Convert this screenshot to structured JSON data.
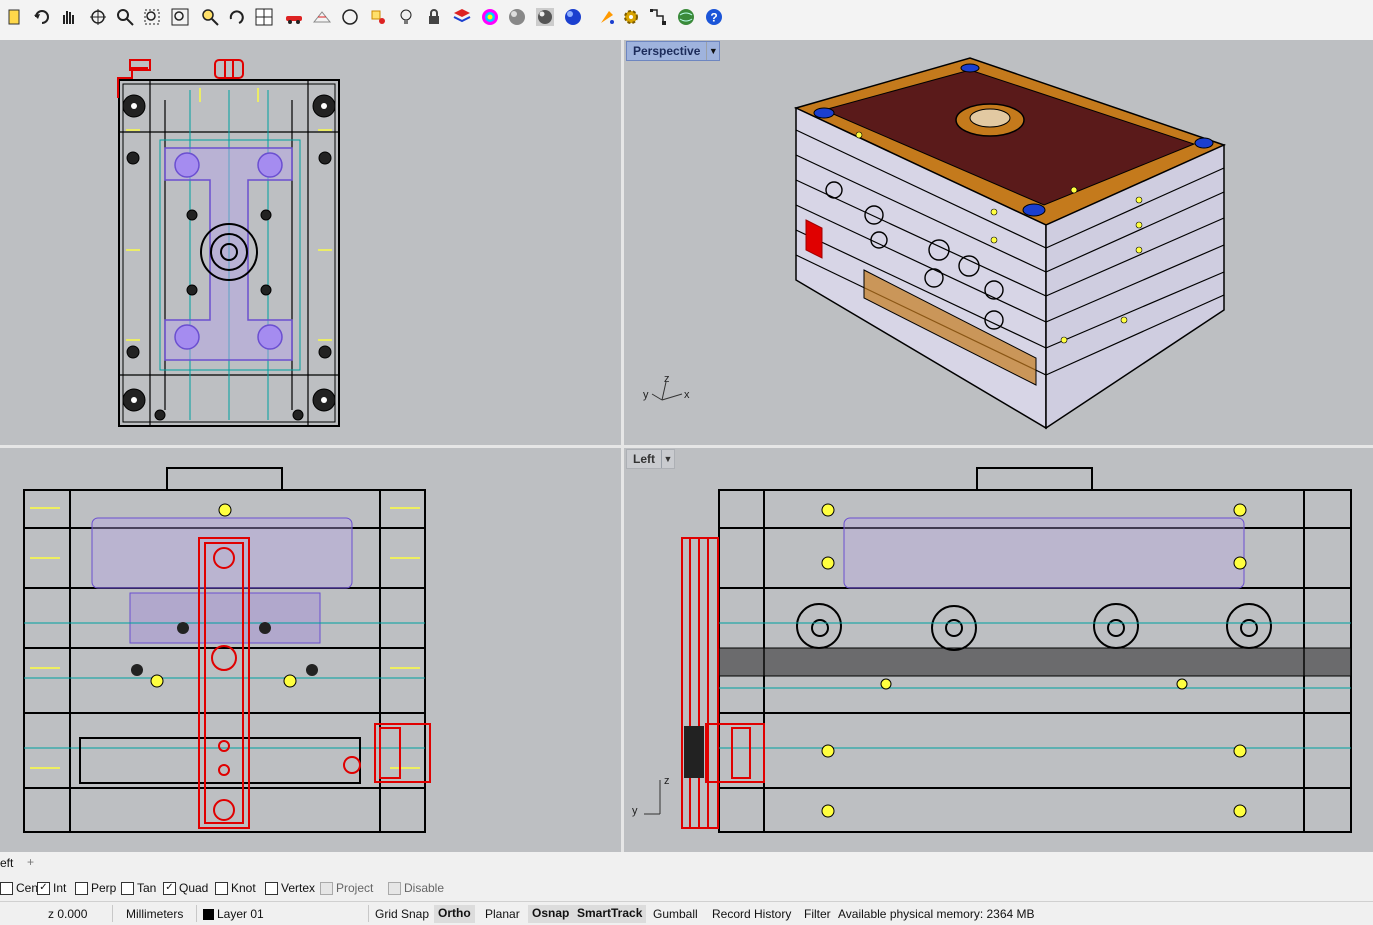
{
  "toolbar": {
    "icons": [
      "new-file-icon",
      "undo-icon",
      "pan-hand-icon",
      "rotate-view-icon",
      "zoom-icon",
      "zoom-window-icon",
      "zoom-extents-icon",
      "zoom-selected-icon",
      "undo-view-icon",
      "four-viewports-icon",
      "car-icon",
      "mesh-icon",
      "circle-tool-icon",
      "osnap-icon",
      "light-bulb-icon",
      "lock-icon",
      "layer-icon",
      "color-wheel-icon",
      "shaded-sphere-icon",
      "rendered-sphere-icon",
      "blue-sphere-icon",
      "paint-icon",
      "gear-icon",
      "flow-icon",
      "globe-icon",
      "help-icon"
    ]
  },
  "viewports": {
    "top_left": {
      "title": ""
    },
    "top_right": {
      "title": "Perspective",
      "active": true
    },
    "bottom_left": {
      "title": ""
    },
    "bottom_right": {
      "title": "Left"
    }
  },
  "axes": {
    "perspective": {
      "x": "x",
      "y": "y",
      "z": "z"
    },
    "left": {
      "y": "y",
      "z": "z"
    }
  },
  "tabs": {
    "current": "eft",
    "add": "+"
  },
  "osnaps": [
    {
      "label": "Cen",
      "checked": false,
      "disabled": false
    },
    {
      "label": "Int",
      "checked": true,
      "disabled": false
    },
    {
      "label": "Perp",
      "checked": false,
      "disabled": false
    },
    {
      "label": "Tan",
      "checked": false,
      "disabled": false
    },
    {
      "label": "Quad",
      "checked": true,
      "disabled": false
    },
    {
      "label": "Knot",
      "checked": false,
      "disabled": false
    },
    {
      "label": "Vertex",
      "checked": false,
      "disabled": false
    },
    {
      "label": "Project",
      "checked": false,
      "disabled": true
    },
    {
      "label": "Disable",
      "checked": false,
      "disabled": true
    }
  ],
  "status": {
    "z": "z 0.000",
    "units": "Millimeters",
    "layer": "Layer 01",
    "grid_snap": "Grid Snap",
    "ortho": "Ortho",
    "planar": "Planar",
    "osnap": "Osnap",
    "smarttrack": "SmartTrack",
    "gumball": "Gumball",
    "record_history": "Record History",
    "filter": "Filter",
    "memory": "Available physical memory: 2364 MB"
  },
  "colors": {
    "viewport_bg": "#bdbfc2",
    "active_title": "#9fb3dd",
    "selection_red": "#e00000",
    "mold_plate": "#d7d5e6",
    "mold_top": "#5a1a1a",
    "mold_frame": "#c47a1c",
    "purple_cavity": "#9a7fe0",
    "cyan_lines": "#00a0a0",
    "yellow_lines": "#ffff40"
  }
}
